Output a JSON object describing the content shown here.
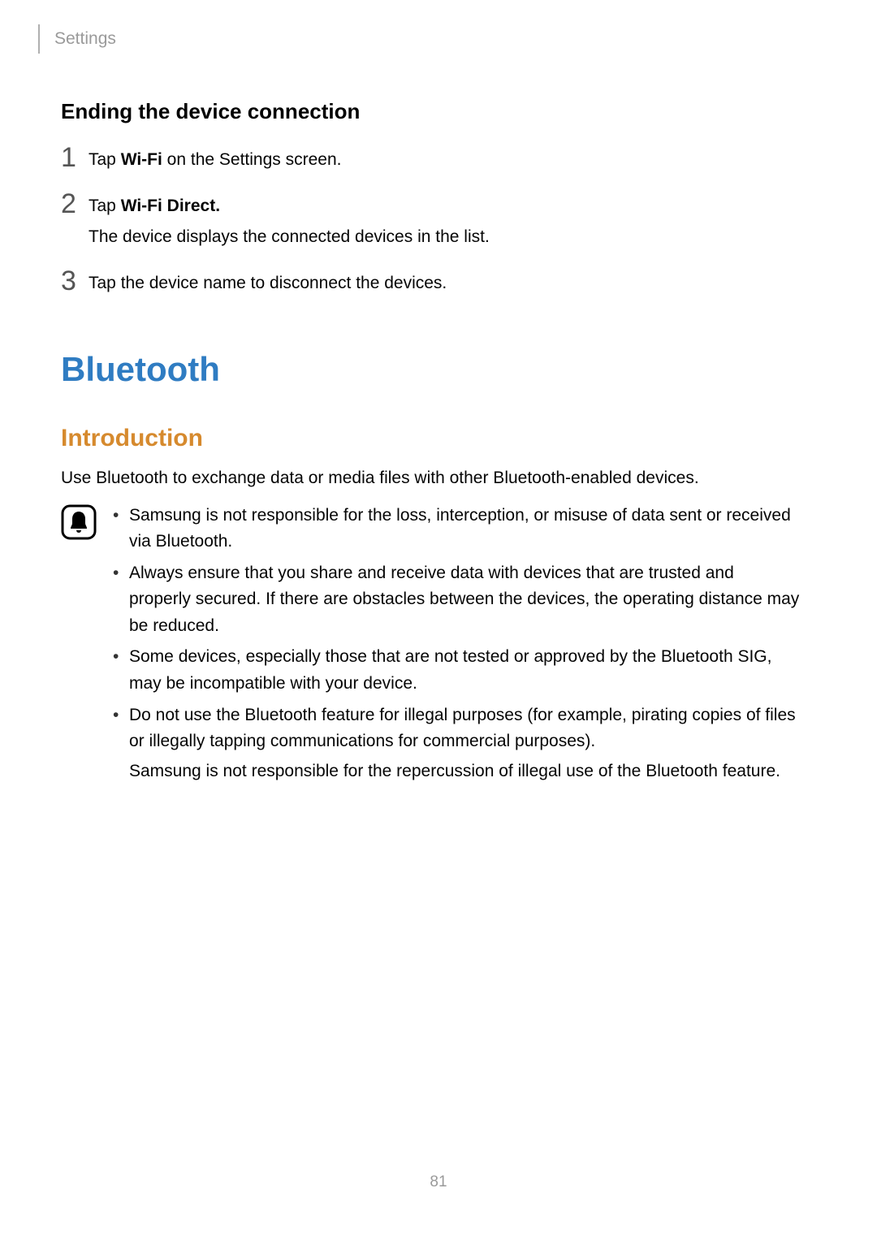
{
  "header": {
    "breadcrumb": "Settings"
  },
  "section_ending": {
    "heading": "Ending the device connection",
    "steps": [
      {
        "num": "1",
        "pre": "Tap ",
        "bold": "Wi-Fi",
        "post": " on the Settings screen."
      },
      {
        "num": "2",
        "pre": "Tap ",
        "bold": "Wi-Fi Direct.",
        "post": "",
        "extra": "The device displays the connected devices in the list."
      },
      {
        "num": "3",
        "pre": "Tap the device name to disconnect the devices.",
        "bold": "",
        "post": ""
      }
    ]
  },
  "chapter": {
    "title": "Bluetooth"
  },
  "subsection": {
    "title": "Introduction",
    "intro": "Use Bluetooth to exchange data or media files with other Bluetooth-enabled devices."
  },
  "notes": [
    {
      "lines": [
        "Samsung is not responsible for the loss, interception, or misuse of data sent or received via Bluetooth."
      ]
    },
    {
      "lines": [
        "Always ensure that you share and receive data with devices that are trusted and properly secured. If there are obstacles between the devices, the operating distance may be reduced."
      ]
    },
    {
      "lines": [
        "Some devices, especially those that are not tested or approved by the Bluetooth SIG, may be incompatible with your device."
      ]
    },
    {
      "lines": [
        "Do not use the Bluetooth feature for illegal purposes (for example, pirating copies of files or illegally tapping communications for commercial purposes).",
        "Samsung is not responsible for the repercussion of illegal use of the Bluetooth feature."
      ]
    }
  ],
  "page_number": "81"
}
